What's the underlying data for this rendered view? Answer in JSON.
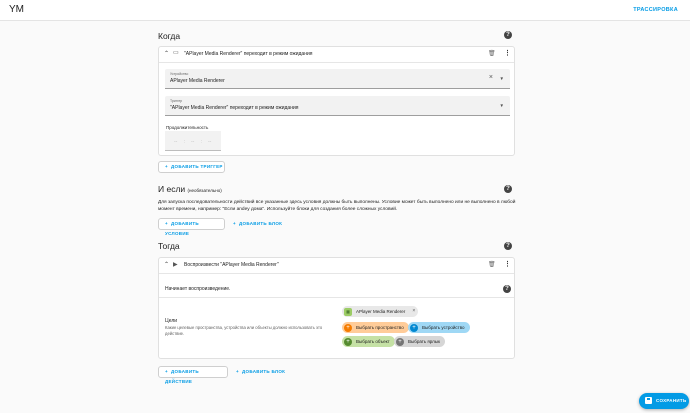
{
  "header": {
    "title": "YM",
    "trace_label": "ТРАССИРОВКА"
  },
  "when": {
    "title": "Когда",
    "trigger": {
      "header_text": "\"APlayer Media Renderer\" переходит в режим ожидания",
      "device_label": "Устройство",
      "device_value": "APlayer Media Renderer",
      "trigger_label": "Триггер",
      "trigger_value": "\"APlayer Media Renderer\" переходит в режим ожидания",
      "duration_label": "Продолжительность",
      "duration_placeholder": [
        "--",
        ":",
        "--",
        ":",
        "--"
      ]
    },
    "add_trigger": "ДОБАВИТЬ ТРИГГЕР"
  },
  "conditions": {
    "title": "И если",
    "optional": "(необязательно)",
    "description": "Для запуска последовательности действий все указанные здесь условия должны быть выполнены. Условие может быть выполнено или не выполнено в любой момент времени, например: \"Если andey дома\". Используйте блоки для создания более сложных условий.",
    "add_condition": "ДОБАВИТЬ УСЛОВИЕ",
    "add_block": "ДОБАВИТЬ БЛОК"
  },
  "then": {
    "title": "Тогда",
    "action": {
      "header_text": "Воспроизвести \"APlayer Media Renderer\"",
      "description": "Начинает воспроизведение.",
      "targets_title": "Цели",
      "targets_help": "Какие целевые пространства, устройства или объекты должно использовать это действие.",
      "entity_chip": "APlayer Media Renderer",
      "chips": {
        "area": "Выбрать пространство",
        "device": "Выбрать устройство",
        "entity": "Выбрать объект",
        "label": "Выбрать ярлык"
      }
    },
    "add_action": "ДОБАВИТЬ ДЕЙСТВИЕ",
    "add_block": "ДОБАВИТЬ БЛОК"
  },
  "save_label": "СОХРАНИТЬ",
  "colors": {
    "accent": "#039be5",
    "area": "#f57c00",
    "device": "#0288d1",
    "entity": "#558b2f"
  }
}
